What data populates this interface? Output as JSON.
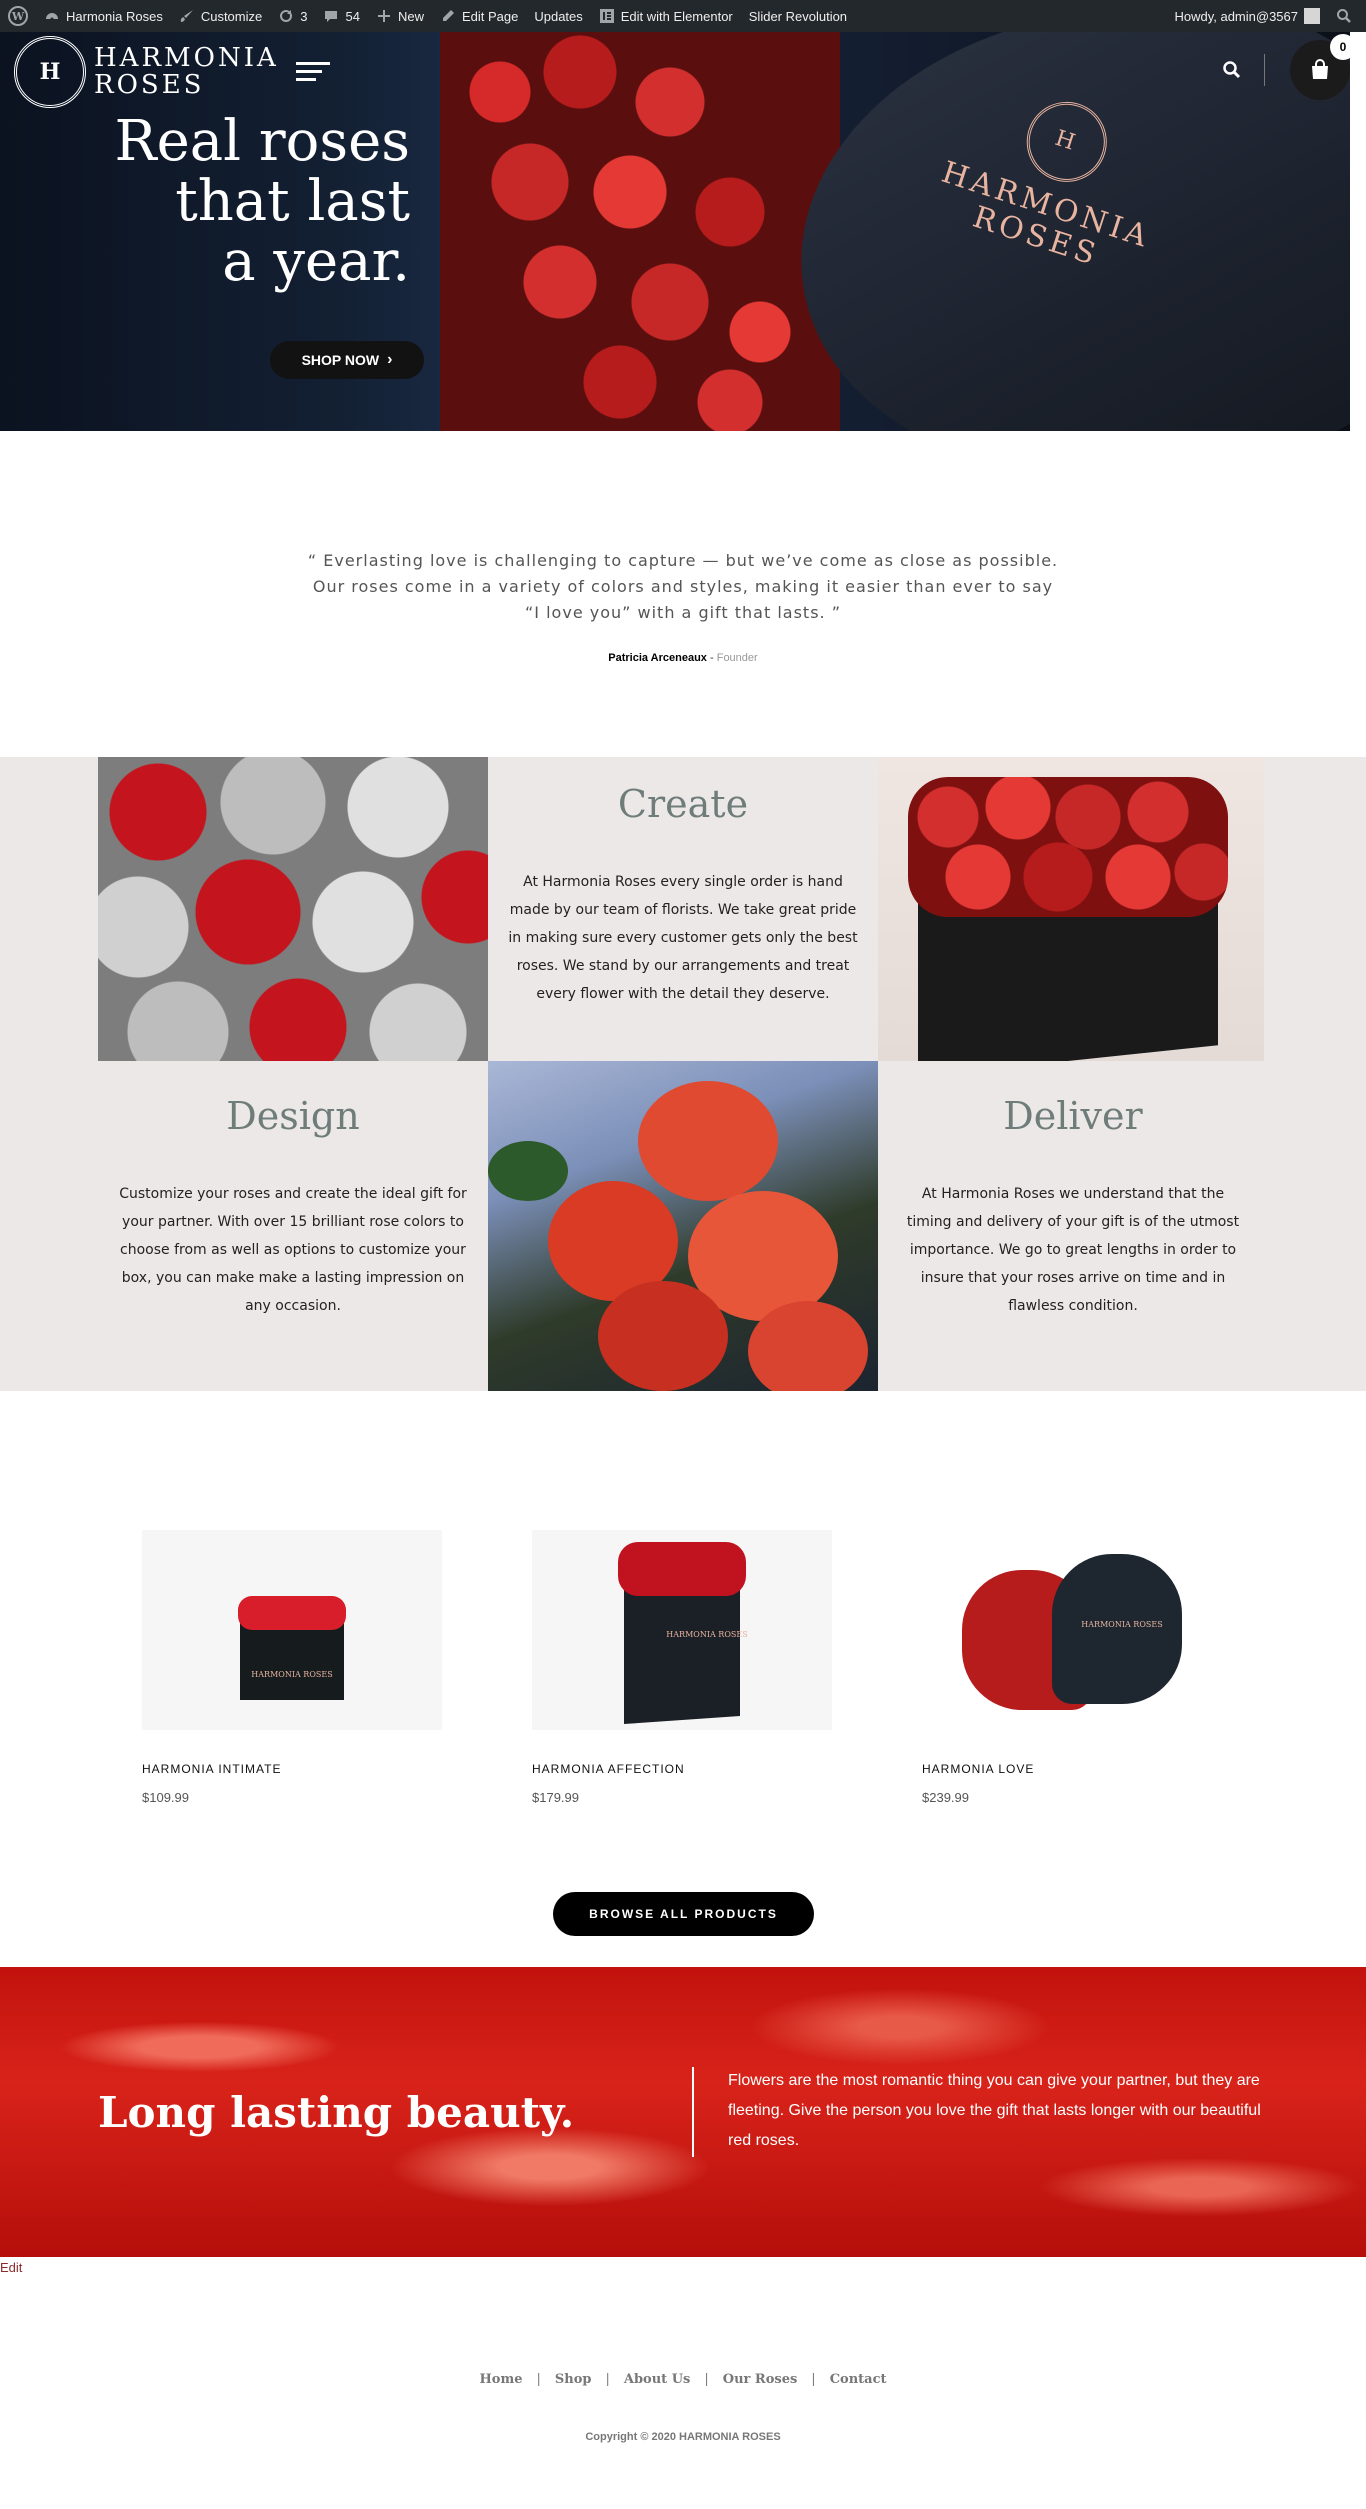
{
  "admin_bar": {
    "site_name": "Harmonia Roses",
    "customize": "Customize",
    "updates_count": "3",
    "comments_count": "54",
    "new": "New",
    "edit_page": "Edit Page",
    "updates": "Updates",
    "edit_with_elementor": "Edit with Elementor",
    "slider_revolution": "Slider Revolution",
    "howdy": "Howdy, admin@3567"
  },
  "header": {
    "brand_line1": "HARMONIA",
    "brand_line2": "ROSES",
    "seal_letter": "H",
    "cart_count": "0"
  },
  "hero": {
    "title_line1": "Real roses",
    "title_line2": "that last",
    "title_line3": "a year.",
    "cta": "SHOP NOW",
    "box_line1": "HARMONIA",
    "box_line2": "ROSES"
  },
  "quote": {
    "text_line1": "“  Everlasting love is challenging to capture — but we’ve come as close as possible.",
    "text_line2": "Our roses come in a variety of colors and styles, making it easier than ever to say",
    "text_line3": "“I love you” with a gift that lasts.  ”",
    "author": "Patricia Arceneaux",
    "separator": " - ",
    "role": "Founder"
  },
  "features": {
    "create": {
      "title": "Create",
      "text": "At Harmonia Roses every single order is hand made by our team of florists. We take great pride in making sure every customer gets only the best roses. We stand by our arrangements and treat every flower with the detail they deserve."
    },
    "design": {
      "title": "Design",
      "text": "Customize your roses and create the ideal gift for your partner. With over 15 brilliant rose colors to choose from as well as options to customize your box, you can make make a lasting impression on any occasion."
    },
    "deliver": {
      "title": "Deliver",
      "text": "At Harmonia Roses we understand that the timing and delivery of your gift is of the utmost importance. We go to great lengths in order to insure that your roses arrive on time and in flawless condition."
    }
  },
  "products": [
    {
      "name": "HARMONIA INTIMATE",
      "price": "$109.99",
      "box_label": "HARMONIA ROSES"
    },
    {
      "name": "HARMONIA AFFECTION",
      "price": "$179.99",
      "box_label": "HARMONIA ROSES"
    },
    {
      "name": "HARMONIA LOVE",
      "price": "$239.99",
      "box_label": "HARMONIA ROSES"
    }
  ],
  "browse_label": "BROWSE ALL PRODUCTS",
  "banner": {
    "title": "Long lasting beauty.",
    "text": "Flowers are the most romantic thing you can give your partner, but they are fleeting. Give the person you love the gift that lasts longer with our beautiful red roses."
  },
  "edit_link": "Edit",
  "footer": {
    "nav": [
      "Home",
      "Shop",
      "About Us",
      "Our Roses",
      "Contact"
    ],
    "copyright": "Copyright © 2020 HARMONIA ROSES"
  },
  "colors": {
    "admin_bar": "#23282d",
    "feature_bg": "#ede8e8",
    "feature_heading": "#6f7d7a",
    "banner_red": "#c2120d",
    "button_black": "#000000"
  },
  "icons": [
    "wordpress-icon",
    "dashboard-icon",
    "brush-icon",
    "refresh-icon",
    "comment-icon",
    "plus-icon",
    "pencil-icon",
    "elementor-icon",
    "search-icon",
    "cart-icon",
    "hamburger-icon",
    "chevron-right-icon"
  ]
}
